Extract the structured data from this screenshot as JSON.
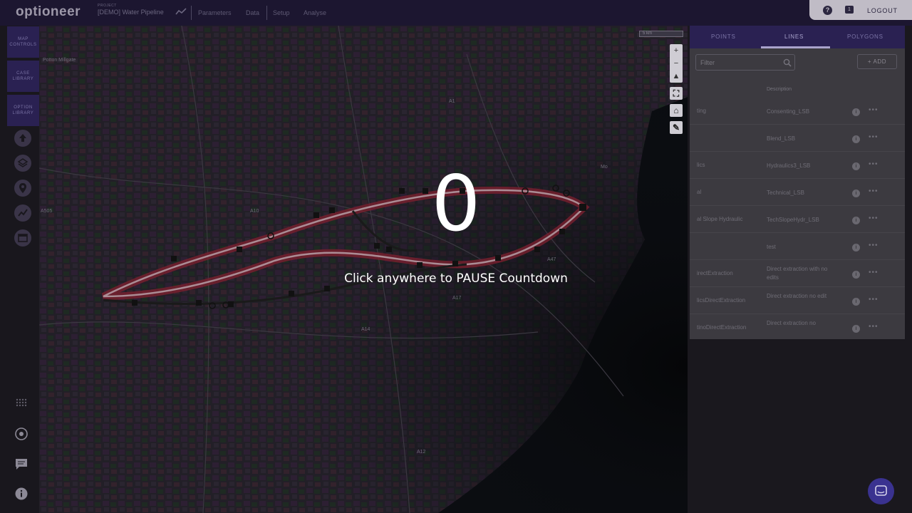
{
  "topbar": {
    "logo": "optioneer",
    "project_small": "PROJECT",
    "project_name": "[DEMO] Water Pipeline",
    "nav": [
      "Parameters",
      "Data",
      "Setup",
      "Analyse"
    ],
    "help_icon": "?",
    "chat_badge": "1",
    "logout": "LOGOUT"
  },
  "leftrail": {
    "tabs": [
      {
        "label": "MAP CONTROLS"
      },
      {
        "label": "CASE LIBRARY"
      },
      {
        "label": "OPTION LIBRARY"
      }
    ],
    "icons": [
      "upload-icon",
      "layers-icon",
      "location-pin-icon",
      "trend-icon",
      "window-icon"
    ],
    "bottom_icons": [
      "grid-icon",
      "target-icon",
      "chat-icon",
      "info-icon"
    ]
  },
  "map": {
    "labels": [
      "Potton  Millgate",
      "Mo",
      "A1",
      "A10",
      "A14",
      "A12",
      "A47",
      "A17",
      "A505"
    ],
    "scale_label": "5 km"
  },
  "panel": {
    "tabs": [
      "POINTS",
      "LINES",
      "POLYGONS"
    ],
    "active_tab": "LINES",
    "filter_placeholder": "Filter",
    "add_label": "ADD",
    "column_header": "Description",
    "rows": [
      {
        "name": "ting",
        "description": "Consenting_LSB"
      },
      {
        "name": "",
        "description": "Blend_LSB"
      },
      {
        "name": "lics",
        "description": "Hydraulics3_LSB"
      },
      {
        "name": "al",
        "description": "Technical_LSB"
      },
      {
        "name": "al Slope Hydraulic",
        "description": "TechSlopeHydr_LSB"
      },
      {
        "name": "",
        "description": "test"
      },
      {
        "name": "irectExtraction",
        "description": "Direct extraction with no edits"
      },
      {
        "name": "licsDirectExtraction",
        "description": "Direct extraction no edit"
      },
      {
        "name": "tinoDirectExtraction",
        "description": "Direct extraction no"
      }
    ]
  },
  "overlay": {
    "countdown": "0",
    "message": "Click anywhere to PAUSE Countdown"
  }
}
